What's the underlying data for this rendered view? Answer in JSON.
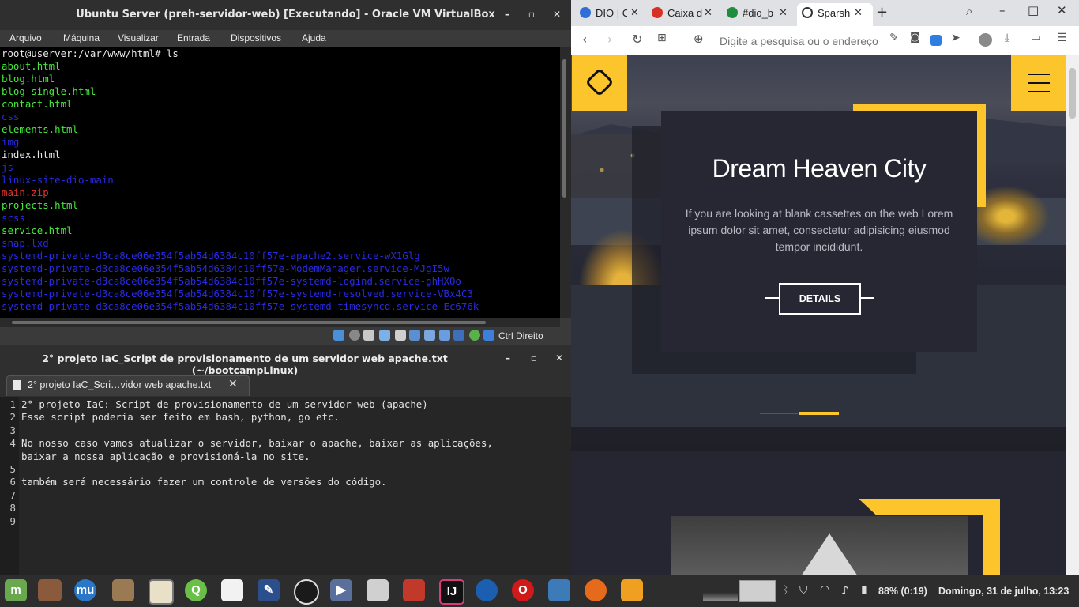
{
  "vbox": {
    "title": "Ubuntu Server (preh-servidor-web) [Executando] - Oracle VM VirtualBox",
    "menu": [
      "Arquivo",
      "Máquina",
      "Visualizar",
      "Entrada",
      "Dispositivos",
      "Ajuda"
    ],
    "host_key": "Ctrl Direito",
    "console": [
      {
        "text": "root@userver:/var/www/html# ls",
        "color": "#e8e8e8"
      },
      {
        "text": "about.html",
        "color": "#45e83a"
      },
      {
        "text": "blog.html",
        "color": "#45e83a"
      },
      {
        "text": "blog-single.html",
        "color": "#45e83a"
      },
      {
        "text": "contact.html",
        "color": "#45e83a"
      },
      {
        "text": "css",
        "color": "#2a2ae6"
      },
      {
        "text": "elements.html",
        "color": "#45e83a"
      },
      {
        "text": "img",
        "color": "#2a2ae6"
      },
      {
        "text": "index.html",
        "color": "#e8e8e8"
      },
      {
        "text": "js",
        "color": "#2a2ae6"
      },
      {
        "text": "linux-site-dio-main",
        "color": "#2a2ae6"
      },
      {
        "text": "main.zip",
        "color": "#e03030"
      },
      {
        "text": "projects.html",
        "color": "#45e83a"
      },
      {
        "text": "scss",
        "color": "#2a2ae6"
      },
      {
        "text": "service.html",
        "color": "#45e83a"
      },
      {
        "text": "snap.lxd",
        "color": "#2a2ae6"
      },
      {
        "text": "systemd-private-d3ca8ce06e354f5ab54d6384c10ff57e-apache2.service-wX1Glg",
        "color": "#2a2ae6"
      },
      {
        "text": "systemd-private-d3ca8ce06e354f5ab54d6384c10ff57e-ModemManager.service-MJgI5w",
        "color": "#2a2ae6"
      },
      {
        "text": "systemd-private-d3ca8ce06e354f5ab54d6384c10ff57e-systemd-logind.service-ghHXOo",
        "color": "#2a2ae6"
      },
      {
        "text": "systemd-private-d3ca8ce06e354f5ab54d6384c10ff57e-systemd-resolved.service-VBx4C3",
        "color": "#2a2ae6"
      },
      {
        "text": "systemd-private-d3ca8ce06e354f5ab54d6384c10ff57e-systemd-timesyncd.service-Ec676k",
        "color": "#2a2ae6"
      }
    ]
  },
  "editor": {
    "title": "2° projeto IaC_Script de provisionamento de um servidor web apache.txt (~/bootcampLinux)",
    "tab_label": "2° projeto IaC_Scri…vidor web apache.txt",
    "lines": [
      {
        "num": "1",
        "text": "2° projeto IaC: Script de provisionamento de um servidor web (apache)"
      },
      {
        "num": "2",
        "text": "Esse script poderia ser feito em bash, python, go etc."
      },
      {
        "num": "3",
        "text": ""
      },
      {
        "num": "4",
        "text": "No nosso caso vamos atualizar o servidor, baixar o apache, baixar as aplicações,"
      },
      {
        "num": "",
        "text": "baixar a nossa aplicação e provisioná-la no site."
      },
      {
        "num": "5",
        "text": ""
      },
      {
        "num": "6",
        "text": "também será necessário fazer um controle de versões do código."
      },
      {
        "num": "7",
        "text": ""
      },
      {
        "num": "8",
        "text": ""
      },
      {
        "num": "9",
        "text": ""
      }
    ]
  },
  "browser": {
    "tabs": [
      {
        "label": "DIO | C",
        "icon_color": "#2f6fd6"
      },
      {
        "label": "Caixa d",
        "icon_color": "#d93025"
      },
      {
        "label": "#dio_b",
        "icon_color": "#1e8e3e"
      },
      {
        "label": "Sparsh",
        "icon_color": "#333333"
      }
    ],
    "address_placeholder": "Digite a pesquisa ou o endereço",
    "hero": {
      "title": "Dream Heaven City",
      "text": "If you are looking at blank cassettes on the web Lorem ipsum dolor sit amet, consectetur adipisicing eiusmod tempor incididunt.",
      "button": "DETAILS"
    },
    "accent_color": "#fdc52c"
  },
  "taskbar": {
    "battery": "88% (0:19)",
    "clock": "Domingo, 31 de julho, 13:23"
  }
}
